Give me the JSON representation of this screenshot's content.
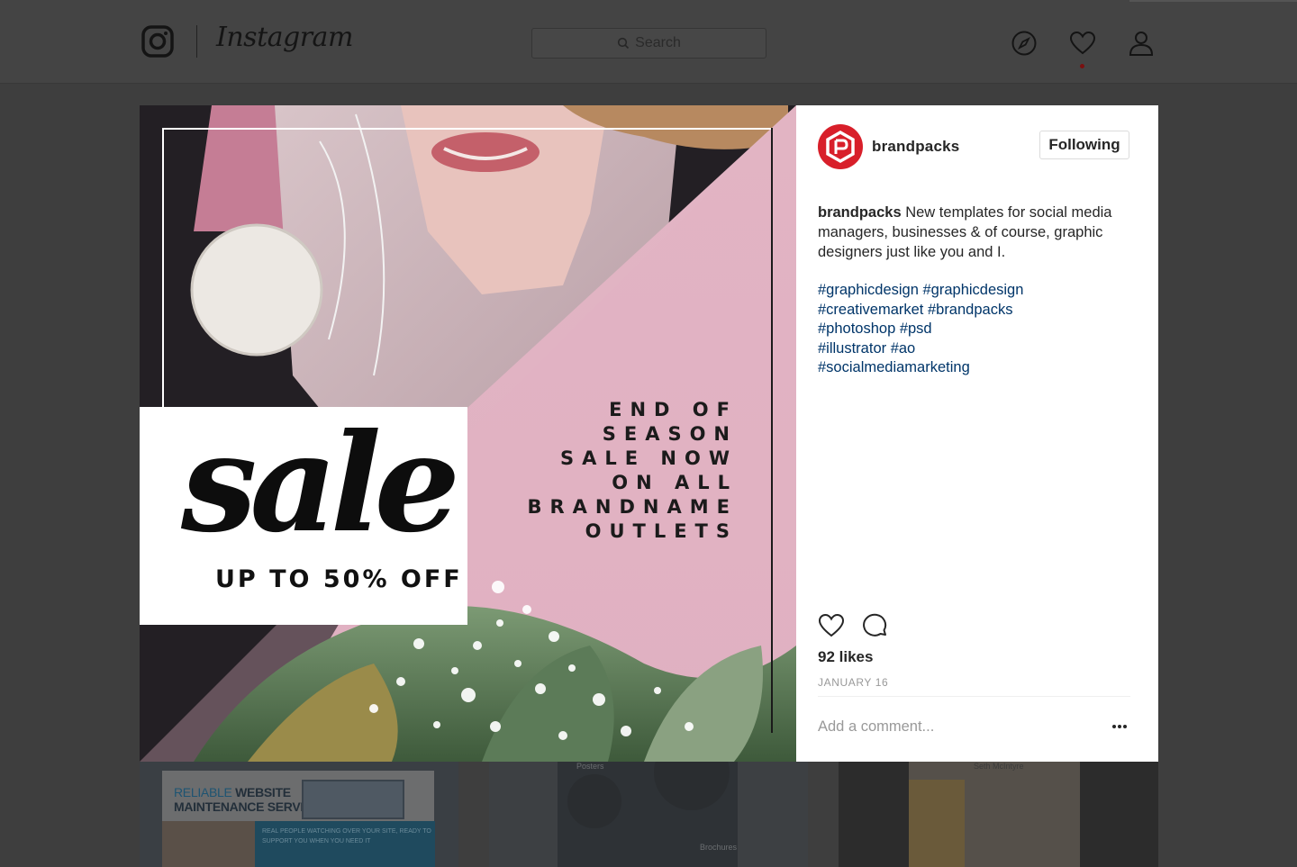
{
  "header": {
    "wordmark": "Instagram",
    "search_placeholder": "Search",
    "icons": [
      "instagram-glyph-icon",
      "search-icon",
      "compass-icon",
      "heart-icon",
      "person-icon"
    ]
  },
  "post": {
    "image": {
      "script_word": "sale",
      "subline": "UP TO 50% OFF",
      "promo_lines": [
        "END OF",
        "SEASON",
        "SALE NOW",
        "ON ALL",
        "BRANDNAME",
        "OUTLETS"
      ]
    },
    "author": "brandpacks",
    "follow_label": "Following",
    "caption_user": "brandpacks",
    "caption_text": "New templates for social media managers, businesses & of course, graphic designers just like you and I.",
    "hashtag_lines": [
      "#graphicdesign #graphicdesign",
      "#creativemarket #brandpacks",
      "#photoshop #psd",
      "#illustrator #ao",
      "#socialmediamarketing"
    ],
    "likes": "92 likes",
    "date": "JANUARY 16",
    "comment_placeholder": "Add a comment..."
  },
  "grid": {
    "tile1": {
      "title_accent": "RELIABLE",
      "title_rest": "WEBSITE",
      "title_line2": "MAINTENANCE SERVICES",
      "panel_text": "REAL PEOPLE WATCHING OVER YOUR SITE, READY TO SUPPORT YOU WHEN YOU NEED IT"
    },
    "tile2": {
      "label_top": "Posters",
      "label_bottom": "Brochures"
    },
    "tile3": {
      "name": "Seth McIntyre"
    }
  },
  "colors": {
    "backdrop": "#3e3e3e",
    "link": "#003569",
    "brand_red": "#d81f2a",
    "pink": "#e8b9ca"
  }
}
